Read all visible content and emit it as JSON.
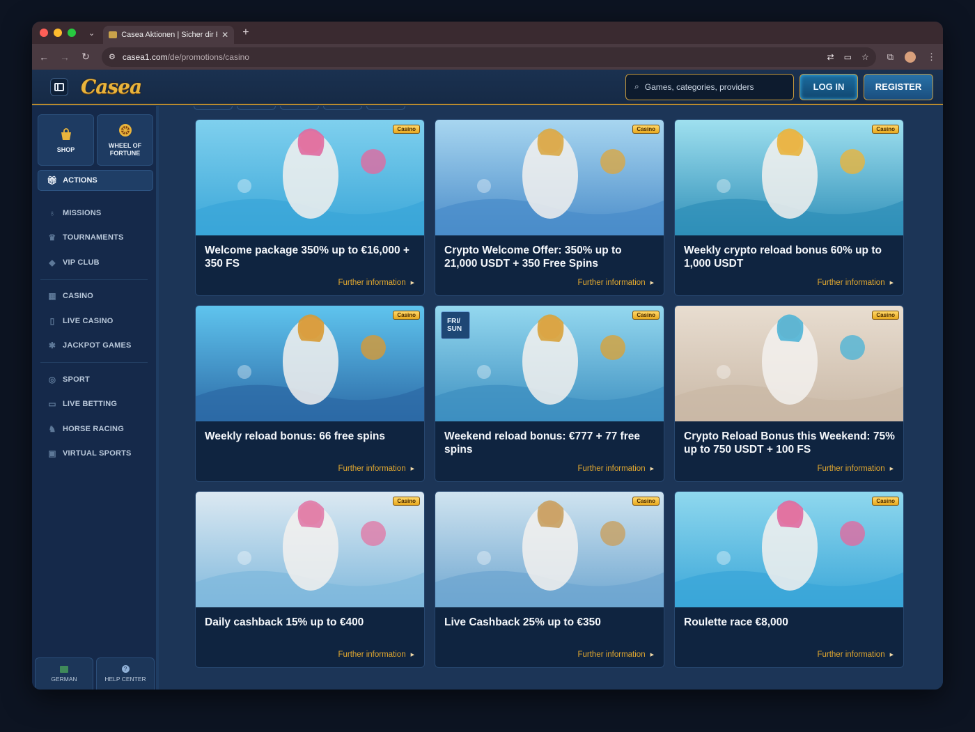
{
  "browser": {
    "tab_title": "Casea Aktionen | Sicher dir F...",
    "tab_close": "✕",
    "new_tab": "+",
    "url_host": "casea1.com",
    "url_path": "/de/promotions/casino"
  },
  "header": {
    "logo": "Casea",
    "search_placeholder": "Games, categories, providers",
    "login_label": "LOG IN",
    "register_label": "REGISTER"
  },
  "sidebar": {
    "tiles": [
      {
        "label": "SHOP",
        "icon": "bag-icon"
      },
      {
        "label": "WHEEL OF FORTUNE",
        "icon": "wheel-icon"
      }
    ],
    "actions_label": "ACTIONS",
    "groups": [
      [
        {
          "label": "MISSIONS",
          "icon": "medal-icon"
        },
        {
          "label": "TOURNAMENTS",
          "icon": "trophy-icon"
        },
        {
          "label": "VIP CLUB",
          "icon": "diamond-icon"
        }
      ],
      [
        {
          "label": "CASINO",
          "icon": "slot-icon"
        },
        {
          "label": "LIVE CASINO",
          "icon": "cards-icon"
        },
        {
          "label": "JACKPOT GAMES",
          "icon": "jackpot-icon"
        }
      ],
      [
        {
          "label": "SPORT",
          "icon": "ball-icon"
        },
        {
          "label": "LIVE BETTING",
          "icon": "live-icon"
        },
        {
          "label": "HORSE RACING",
          "icon": "horse-icon"
        },
        {
          "label": "VIRTUAL SPORTS",
          "icon": "monitor-icon"
        }
      ]
    ],
    "footer": {
      "language_label": "GERMAN",
      "help_label": "HELP CENTER"
    }
  },
  "promotions": [
    {
      "title": "Welcome package 350% up to €16,000 + 350 FS",
      "badge": "Casino",
      "link": "Further information",
      "palette": [
        "#3aa6d8",
        "#7fd0ee",
        "#e06aa0"
      ]
    },
    {
      "title": "Crypto Welcome Offer: 350% up to 21,000 USDT + 350 Free Spins",
      "badge": "Casino",
      "link": "Further information",
      "palette": [
        "#4a8cc9",
        "#a8d6f0",
        "#d9a845"
      ]
    },
    {
      "title": "Weekly crypto reload bonus 60% up to 1,000 USDT",
      "badge": "Casino",
      "link": "Further information",
      "palette": [
        "#2f8fb8",
        "#9fe0ef",
        "#e9b43c"
      ]
    },
    {
      "title": "Weekly reload bonus: 66 free spins",
      "badge": "Casino",
      "link": "Further information",
      "palette": [
        "#2c6aa6",
        "#5fc4ee",
        "#d79a34"
      ]
    },
    {
      "title": "Weekend reload bonus: €777 + 77 free spins",
      "badge": "Casino",
      "link": "Further information",
      "palette": [
        "#3d8fc0",
        "#94d8ef",
        "#d8a23a"
      ],
      "corner_tag": [
        "FRI/",
        "SUN"
      ]
    },
    {
      "title": "Crypto Reload Bonus this Weekend: 75% up to 750 USDT + 100 FS",
      "badge": "Casino",
      "link": "Further information",
      "palette": [
        "#c9b8a6",
        "#e8ddd0",
        "#4fb4d6"
      ]
    },
    {
      "title": "Daily cashback 15% up to €400",
      "badge": "Casino",
      "link": "Further information",
      "palette": [
        "#7fb8dc",
        "#dce9f2",
        "#e07aa8"
      ]
    },
    {
      "title": "Live Cashback 25% up to €350",
      "badge": "Casino",
      "link": "Further information",
      "palette": [
        "#6ea6d0",
        "#d0e4f0",
        "#c8a060"
      ]
    },
    {
      "title": "Roulette race €8,000",
      "badge": "Casino",
      "link": "Further information",
      "palette": [
        "#3aa6d8",
        "#8fd8ee",
        "#e06aa0"
      ]
    }
  ]
}
